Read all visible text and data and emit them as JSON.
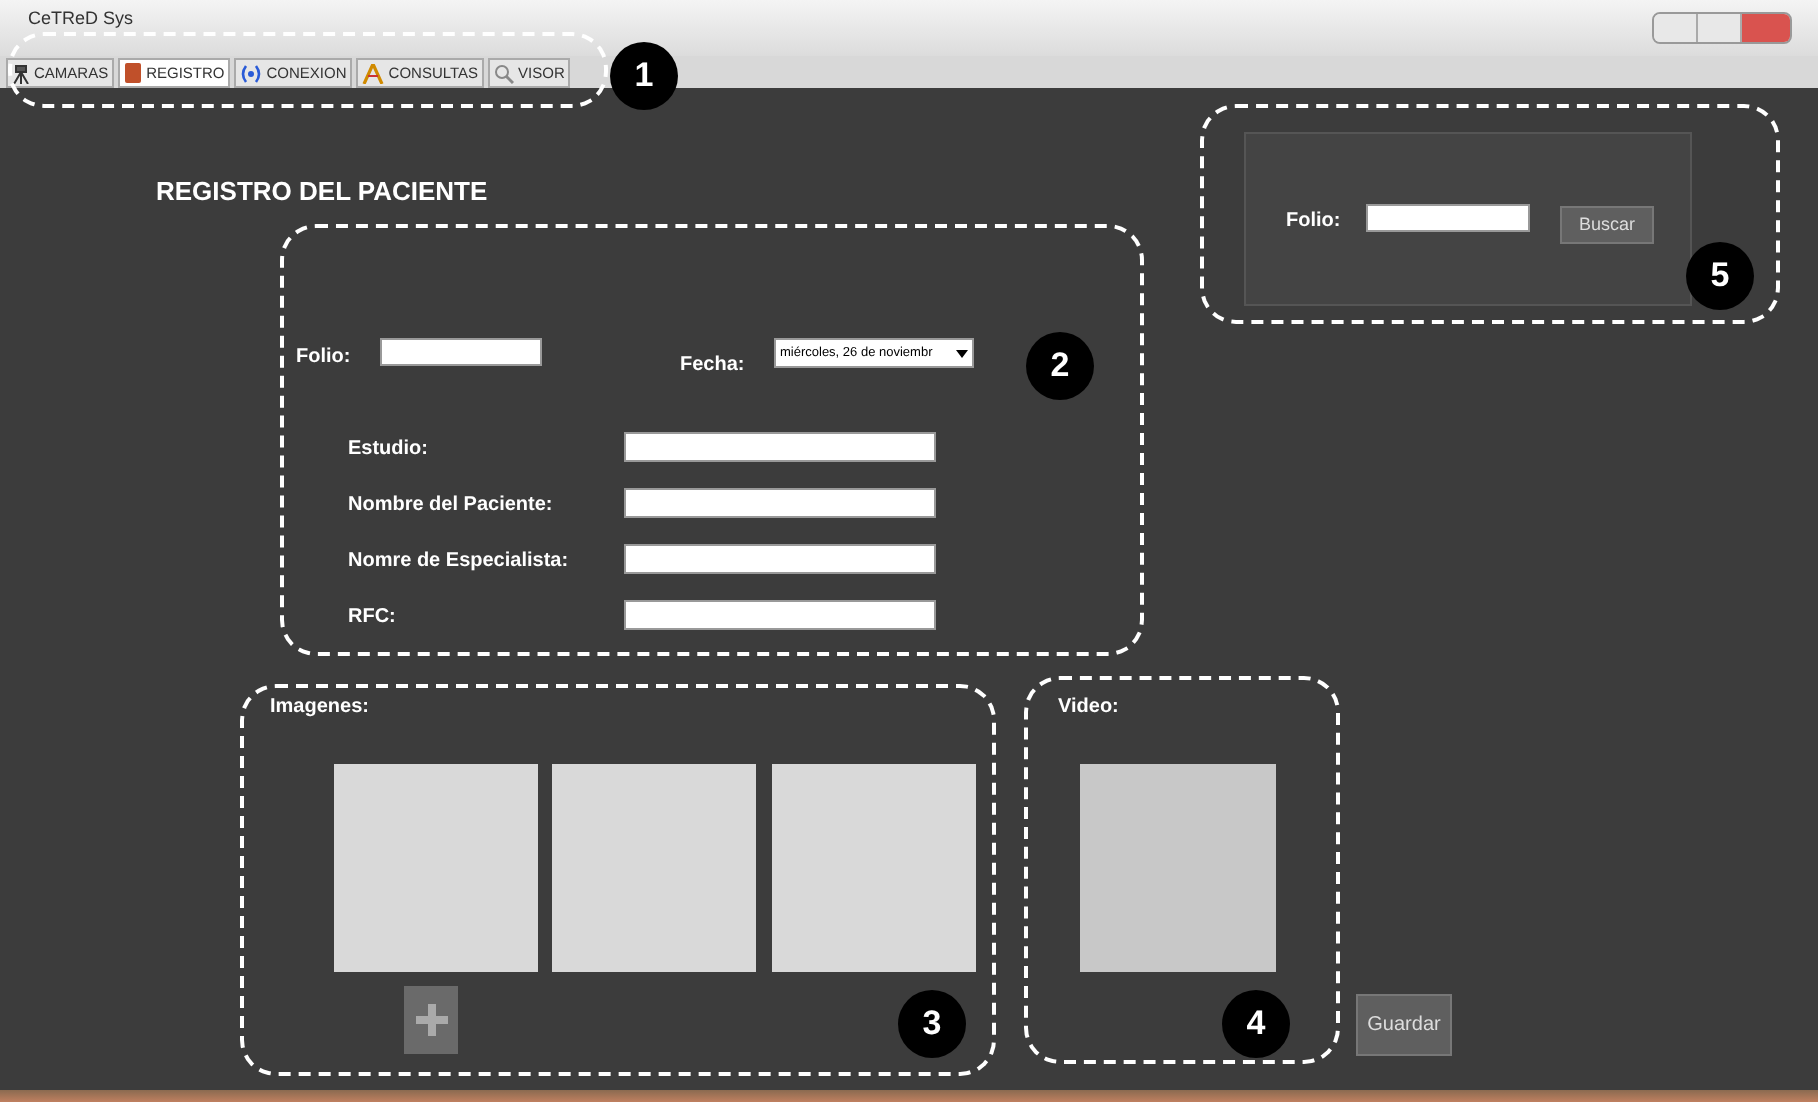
{
  "window": {
    "title": "CeTReD Sys"
  },
  "tabs": [
    {
      "label": "CAMARAS",
      "selected": false
    },
    {
      "label": "REGISTRO",
      "selected": true
    },
    {
      "label": "CONEXION",
      "selected": false
    },
    {
      "label": "CONSULTAS",
      "selected": false
    },
    {
      "label": "VISOR",
      "selected": false
    }
  ],
  "heading": "REGISTRO DEL PACIENTE",
  "folio": {
    "label": "Folio:"
  },
  "fecha": {
    "label": "Fecha:",
    "value": "miércoles, 26 de noviembr"
  },
  "fields": [
    {
      "label": "Estudio:"
    },
    {
      "label": "Nombre del Paciente:"
    },
    {
      "label": "Nomre de Especialista:"
    },
    {
      "label": "RFC:"
    }
  ],
  "search": {
    "label": "Folio:",
    "button": "Buscar"
  },
  "images": {
    "label": "Imagenes:"
  },
  "video": {
    "label": "Video:"
  },
  "save_button": "Guardar",
  "callouts": [
    "1",
    "2",
    "3",
    "4",
    "5"
  ]
}
